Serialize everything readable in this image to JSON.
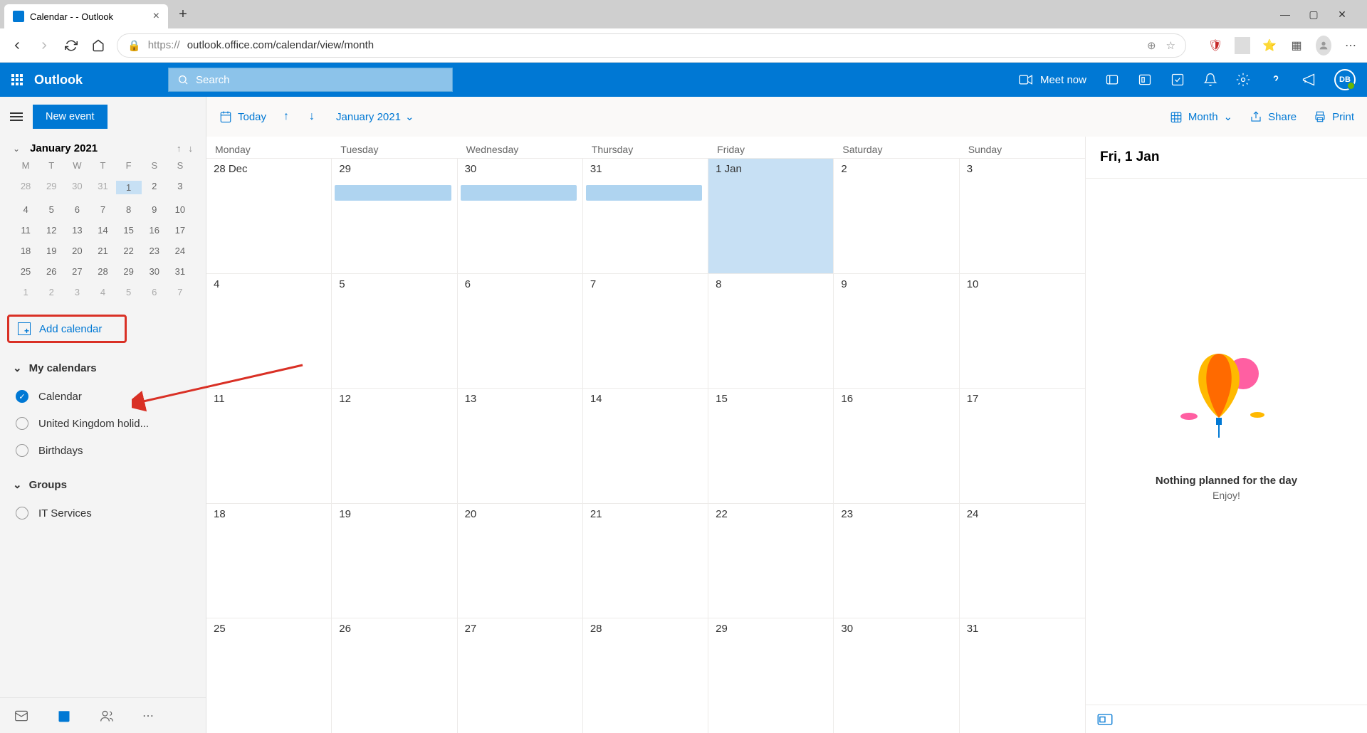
{
  "browser": {
    "tab_title": "Calendar -                  - Outlook",
    "url_prefix": "https://",
    "url_rest": "outlook.office.com/calendar/view/month"
  },
  "header": {
    "brand": "Outlook",
    "search_placeholder": "Search",
    "meet_now": "Meet now",
    "avatar_initials": "DB"
  },
  "sidebar": {
    "new_event": "New event",
    "mini_cal_title": "January 2021",
    "mini_days": [
      "M",
      "T",
      "W",
      "T",
      "F",
      "S",
      "S"
    ],
    "add_calendar": "Add calendar",
    "my_calendars": "My calendars",
    "calendars": [
      {
        "label": "Calendar",
        "checked": true
      },
      {
        "label": "United Kingdom holid...",
        "checked": false
      },
      {
        "label": "Birthdays",
        "checked": false
      }
    ],
    "groups": "Groups",
    "group_items": [
      {
        "label": "IT Services",
        "checked": false
      }
    ]
  },
  "toolbar": {
    "today": "Today",
    "month_label": "January 2021",
    "view": "Month",
    "share": "Share",
    "print": "Print"
  },
  "grid": {
    "day_headers": [
      "Monday",
      "Tuesday",
      "Wednesday",
      "Thursday",
      "Friday",
      "Saturday",
      "Sunday"
    ],
    "weeks": [
      [
        "28 Dec",
        "29",
        "30",
        "31",
        "1 Jan",
        "2",
        "3"
      ],
      [
        "4",
        "5",
        "6",
        "7",
        "8",
        "9",
        "10"
      ],
      [
        "11",
        "12",
        "13",
        "14",
        "15",
        "16",
        "17"
      ],
      [
        "18",
        "19",
        "20",
        "21",
        "22",
        "23",
        "24"
      ],
      [
        "25",
        "26",
        "27",
        "28",
        "29",
        "30",
        "31"
      ]
    ],
    "today_cell": [
      0,
      4
    ],
    "event_bars": [
      [
        0,
        1
      ],
      [
        0,
        2
      ],
      [
        0,
        3
      ]
    ]
  },
  "mini_weeks": [
    [
      "28",
      "29",
      "30",
      "31",
      "1",
      "2",
      "3"
    ],
    [
      "4",
      "5",
      "6",
      "7",
      "8",
      "9",
      "10"
    ],
    [
      "11",
      "12",
      "13",
      "14",
      "15",
      "16",
      "17"
    ],
    [
      "18",
      "19",
      "20",
      "21",
      "22",
      "23",
      "24"
    ],
    [
      "25",
      "26",
      "27",
      "28",
      "29",
      "30",
      "31"
    ],
    [
      "1",
      "2",
      "3",
      "4",
      "5",
      "6",
      "7"
    ]
  ],
  "right_panel": {
    "date": "Fri, 1 Jan",
    "empty_title": "Nothing planned for the day",
    "empty_sub": "Enjoy!"
  }
}
